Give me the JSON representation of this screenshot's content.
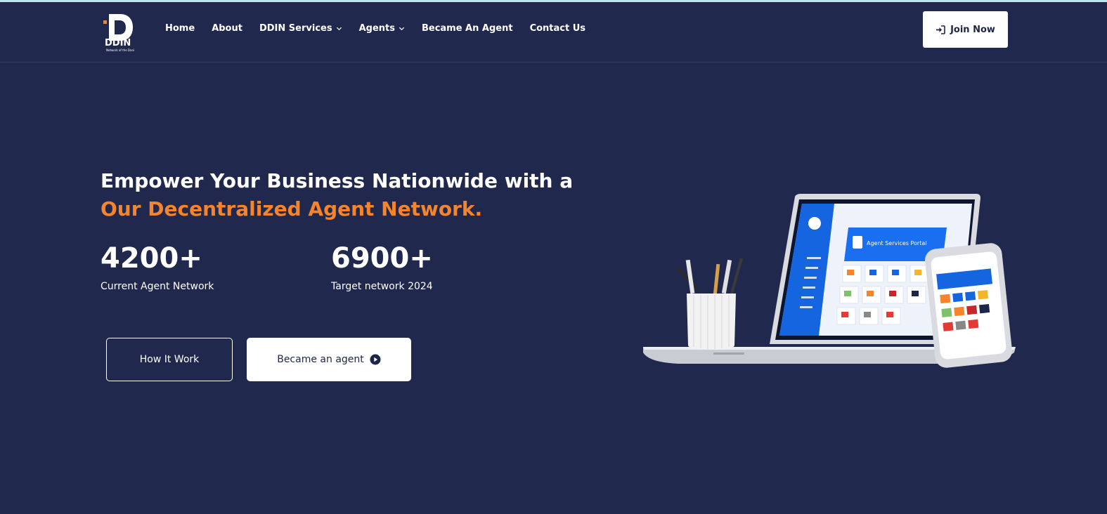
{
  "logo": {
    "name": "DDIN",
    "tagline": "Network of the Dani"
  },
  "nav": {
    "items": [
      {
        "label": "Home",
        "dropdown": false
      },
      {
        "label": "About",
        "dropdown": false
      },
      {
        "label": "DDIN Services",
        "dropdown": true
      },
      {
        "label": "Agents",
        "dropdown": true
      },
      {
        "label": "Became An Agent",
        "dropdown": false
      },
      {
        "label": "Contact Us",
        "dropdown": false
      }
    ],
    "join_label": "Join Now"
  },
  "hero": {
    "title_line1": "Empower Your Business Nationwide with a",
    "title_line2": "Our Decentralized Agent Network.",
    "stats": [
      {
        "value": "4200+",
        "label": "Current Agent Network"
      },
      {
        "value": "6900+",
        "label": "Target network 2024"
      }
    ],
    "how_label": "How It Work",
    "agent_label": "Became an agent"
  },
  "illustration": {
    "portal_title": "Agent Services Portal"
  },
  "colors": {
    "background": "#20294d",
    "accent": "#f5842b",
    "text": "#ffffff"
  }
}
